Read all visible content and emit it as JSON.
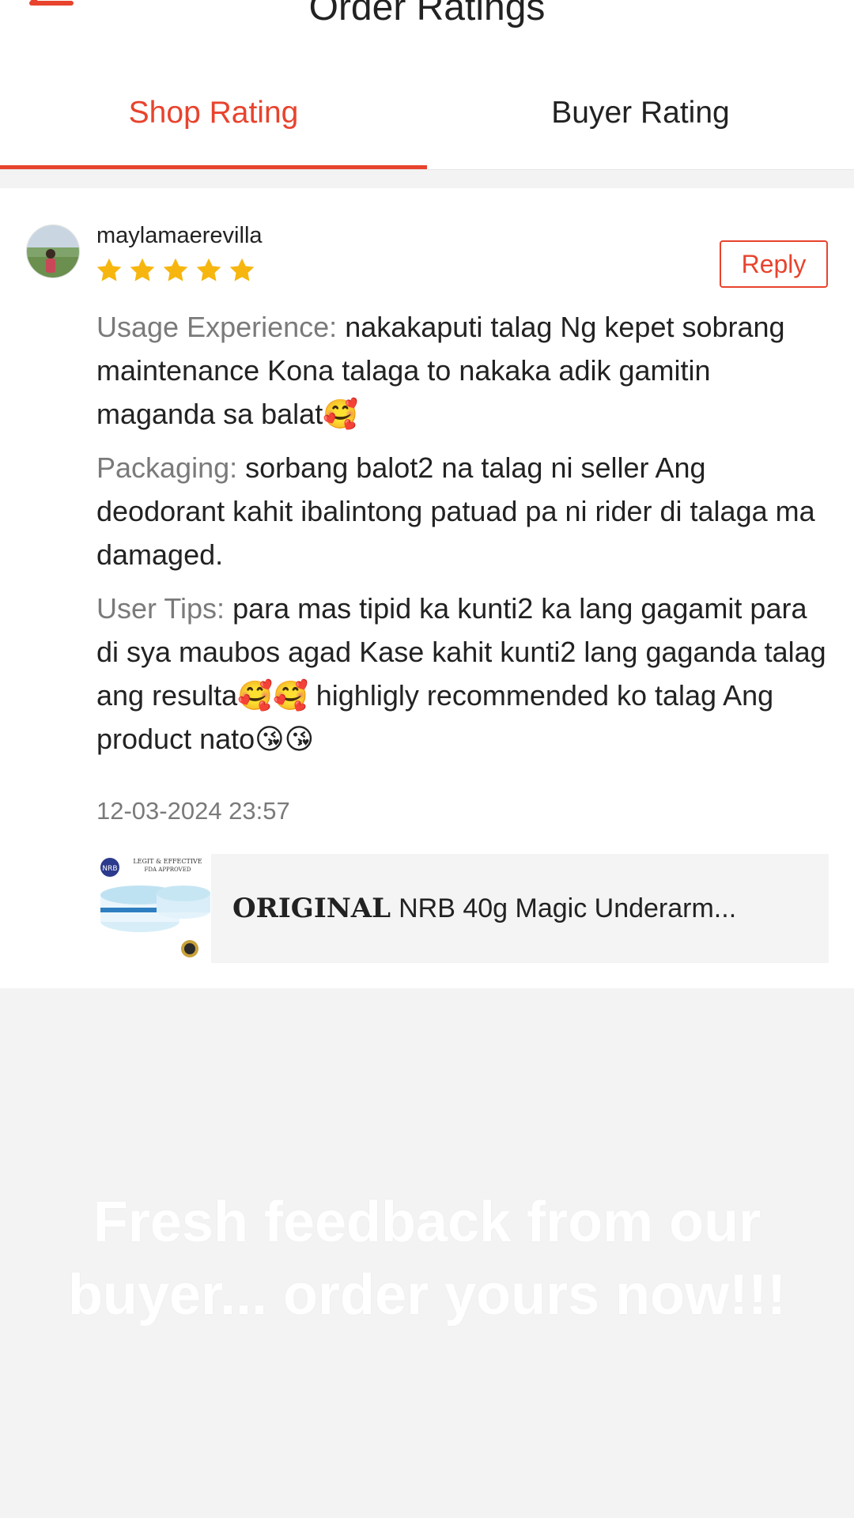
{
  "header": {
    "title": "Order Ratings"
  },
  "tabs": [
    {
      "label": "Shop Rating",
      "active": true
    },
    {
      "label": "Buyer Rating",
      "active": false
    }
  ],
  "colors": {
    "accent": "#e8432d",
    "star": "#f6b60f",
    "muted_text": "#7a7a7a",
    "background": "#f3f3f3"
  },
  "review": {
    "username": "maylamaerevilla",
    "rating": 5,
    "reply_label": "Reply",
    "fields": [
      {
        "label": "Usage Experience:",
        "text": "nakakaputi talag Ng kepet sobrang maintenance Kona talaga to nakaka adik gamitin maganda sa balat🥰"
      },
      {
        "label": "Packaging:",
        "text": "sorbang balot2 na talag ni seller Ang deodorant kahit ibalintong patuad pa ni rider di talaga ma damaged."
      },
      {
        "label": "User Tips:",
        "text": "para mas tipid ka kunti2 ka lang gagamit para di sya maubos agad Kase kahit kunti2 lang gaganda talag ang resulta🥰🥰 highligly recommended ko talag Ang product nato😘😘"
      }
    ],
    "timestamp": "12-03-2024 23:57"
  },
  "product": {
    "name_bold": "ORIGINAL",
    "name_rest": "NRB 40g Magic Underarm...",
    "thumb_text_top": "LEGIT & EFFECTIVE",
    "thumb_text_sub": "FDA APPROVED",
    "thumb_brand": "NRB"
  },
  "overlay": {
    "caption": "Fresh feedback from our buyer... order yours now!!!"
  }
}
